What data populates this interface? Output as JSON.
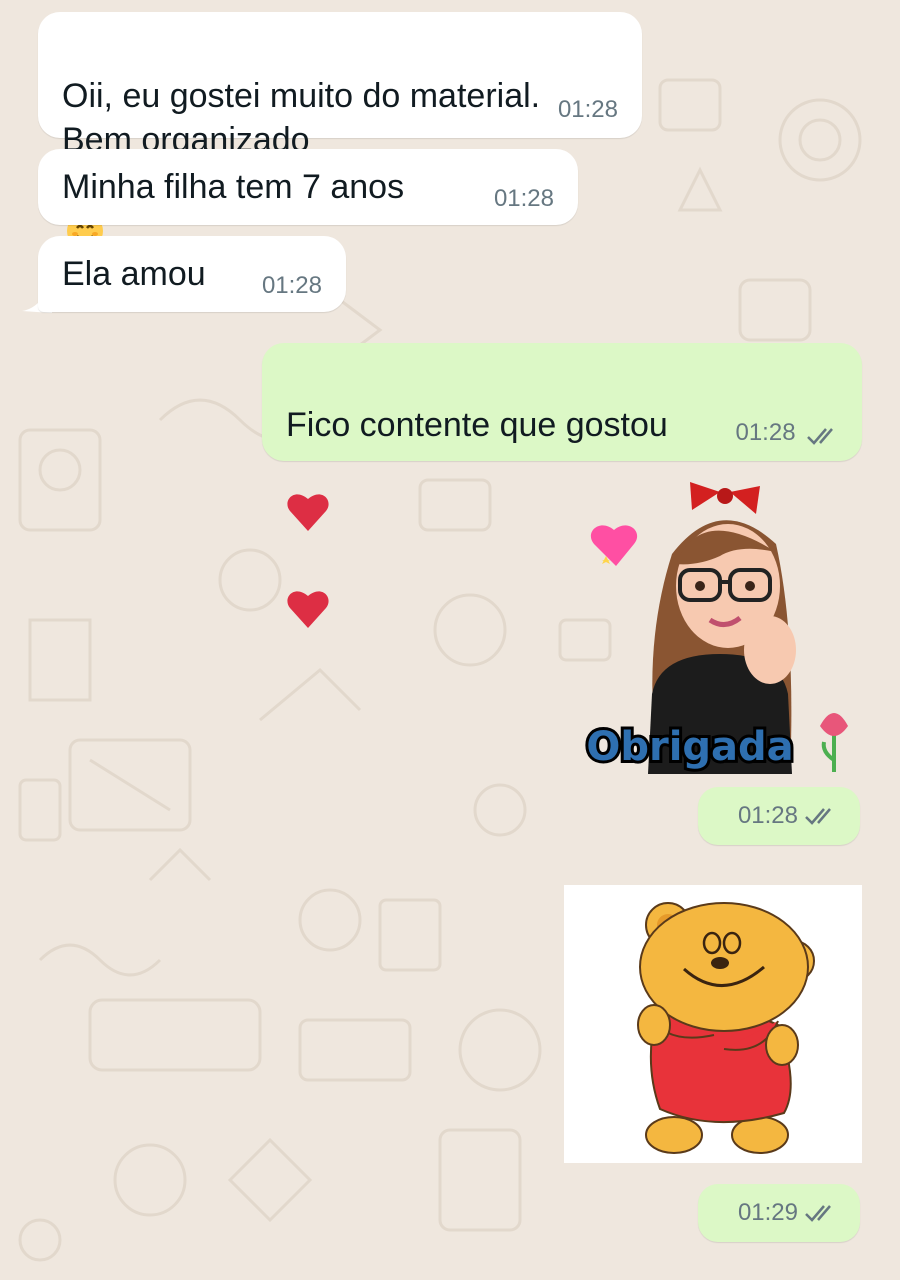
{
  "chat": {
    "messages": [
      {
        "direction": "incoming",
        "text": "Oii, eu gostei muito do material.\nBem organizado",
        "emoji": "smiling-face-with-hearts",
        "time": "01:28"
      },
      {
        "direction": "incoming",
        "text": "Minha filha tem 7 anos",
        "time": "01:28"
      },
      {
        "direction": "incoming",
        "text": "Ela amou",
        "time": "01:28"
      },
      {
        "direction": "outgoing",
        "text": "Fico contente que gostou",
        "emoji": "red-heart x2",
        "time": "01:28",
        "status": "read"
      },
      {
        "direction": "outgoing",
        "type": "sticker",
        "sticker_caption": "Obrigada",
        "time": "01:28",
        "status": "read"
      },
      {
        "direction": "outgoing",
        "type": "sticker",
        "sticker_name": "teddy-bear-hug",
        "time": "01:29",
        "status": "read"
      }
    ]
  },
  "colors": {
    "wallpaper": "#efe7de",
    "incoming_bubble": "#ffffff",
    "outgoing_bubble": "#dcf8c6",
    "timestamp": "#667781",
    "read_ticks": "#667781"
  }
}
